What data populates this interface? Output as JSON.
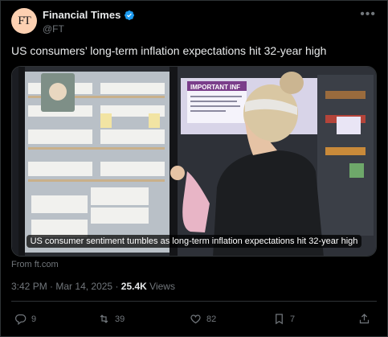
{
  "account": {
    "avatar_text": "FT",
    "name": "Financial Times",
    "handle": "@FT",
    "verified": true,
    "avatar_color": "#fcd0b1"
  },
  "tweet": {
    "text": "US consumers’ long-term inflation expectations hit 32-year high"
  },
  "card": {
    "caption": "US consumer sentiment tumbles as long-term inflation expectations hit 32-year high",
    "sign_text": "IMPORTANT INF",
    "image_description_icon": "photo"
  },
  "source": "From ft.com",
  "meta": {
    "time": "3:42 PM",
    "date": "Mar 14, 2025",
    "views_count": "25.4K",
    "views_label": "Views"
  },
  "actions": {
    "replies": "9",
    "reposts": "39",
    "likes": "82",
    "bookmarks": "7"
  },
  "colors": {
    "background": "#000000",
    "text_primary": "#e7e9ea",
    "text_secondary": "#71767b",
    "verified_blue": "#1d9bf0",
    "border": "#2f3336"
  }
}
